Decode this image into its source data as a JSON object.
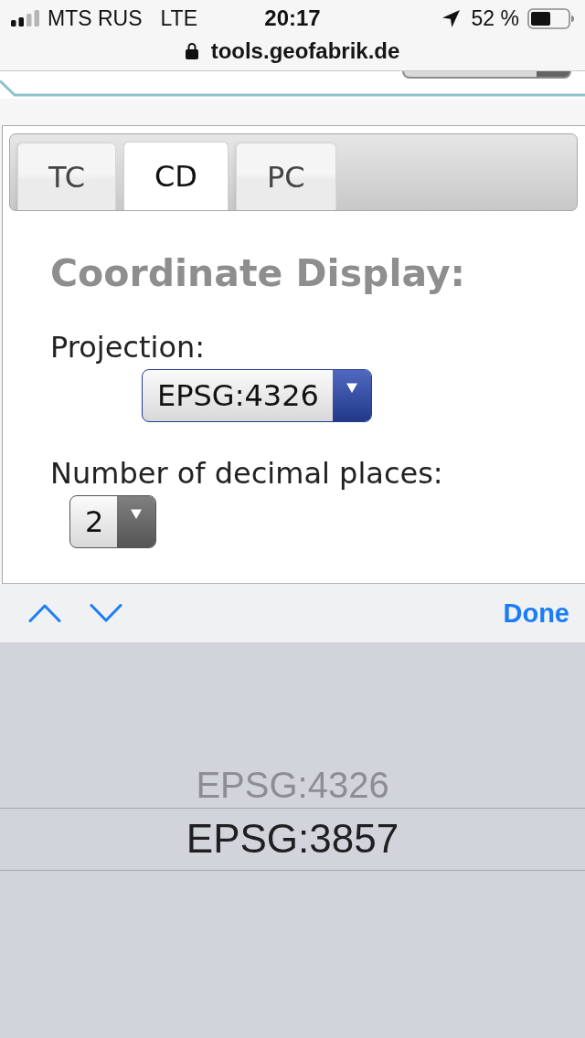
{
  "status_bar": {
    "carrier": "MTS RUS",
    "network": "LTE",
    "time": "20:17",
    "battery": "52 %"
  },
  "address_bar": {
    "url": "tools.geofabrik.de"
  },
  "tabs": [
    {
      "label": "TC",
      "selected": false
    },
    {
      "label": "CD",
      "selected": true
    },
    {
      "label": "PC",
      "selected": false
    }
  ],
  "panel": {
    "title": "Coordinate Display:",
    "fields": [
      {
        "label": "Projection:",
        "value": "EPSG:4326",
        "focused": true
      },
      {
        "label": "Number of decimal places:",
        "value": "2",
        "focused": false
      }
    ]
  },
  "keyboard_toolbar": {
    "done": "Done"
  },
  "picker": {
    "options": [
      {
        "label": "EPSG:4326",
        "selected": false
      },
      {
        "label": "EPSG:3857",
        "selected": true
      }
    ]
  }
}
